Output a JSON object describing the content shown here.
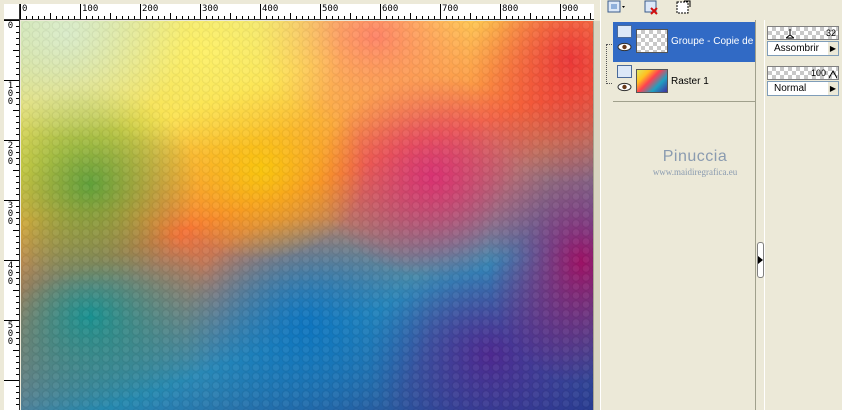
{
  "ruler": {
    "horizontal_labels": [
      "0",
      "100",
      "200",
      "300",
      "400",
      "500",
      "600",
      "700",
      "800",
      "900"
    ],
    "vertical_labels": [
      "0",
      "1\n0\n0",
      "2\n0\n0",
      "3\n0\n0",
      "4\n0\n0",
      "5\n0\n0"
    ]
  },
  "layers": [
    {
      "name": "Groupe - Copie de R",
      "selected": true,
      "opacity": "32",
      "blend_mode": "Assombrir",
      "thumbnail": "transparent"
    },
    {
      "name": "Raster 1",
      "selected": false,
      "opacity": "100",
      "blend_mode": "Normal",
      "thumbnail": "rainbow-gradient"
    }
  ],
  "watermark": {
    "name": "Pinuccia",
    "url": "www.maidiregrafica.eu"
  },
  "toolbar": {
    "icons": [
      "new-layer-icon",
      "delete-layer-icon",
      "mask-icon"
    ]
  },
  "colors": {
    "selection": "#316ac5",
    "panel": "#ece9d8"
  }
}
